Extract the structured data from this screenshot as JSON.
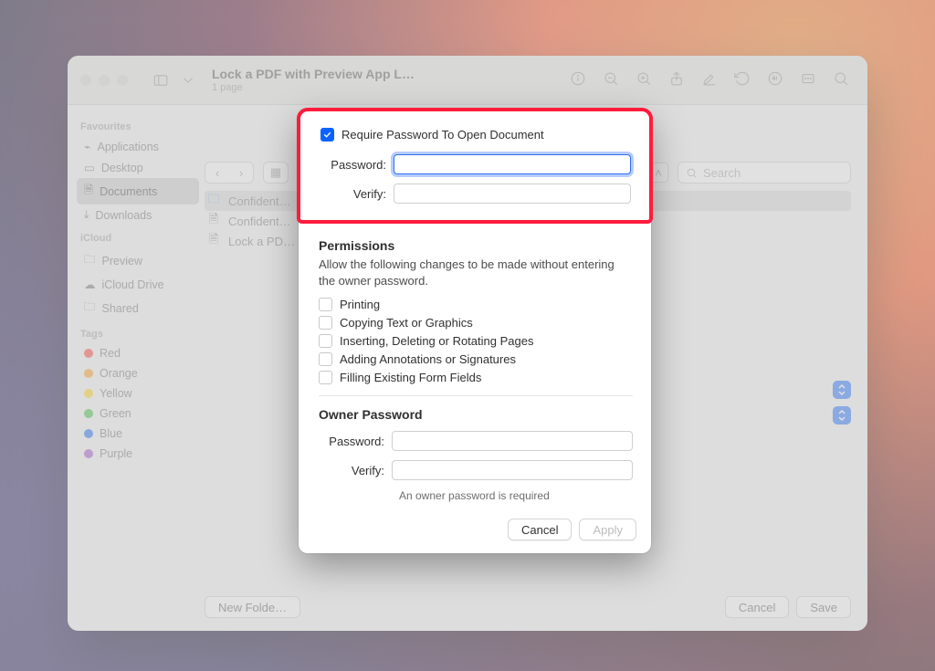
{
  "window": {
    "title": "Lock a PDF with Preview App L…",
    "subtitle": "1 page"
  },
  "sidebar": {
    "groups": [
      {
        "header": "Favourites",
        "items": [
          "Applications",
          "Desktop",
          "Documents",
          "Downloads"
        ],
        "selectedIndex": 2
      },
      {
        "header": "iCloud",
        "items": [
          "Preview",
          "iCloud Drive",
          "Shared"
        ]
      },
      {
        "header": "Tags",
        "items": [
          "Red",
          "Orange",
          "Yellow",
          "Green",
          "Blue",
          "Purple"
        ],
        "colors": [
          "#ff5b56",
          "#ffab3d",
          "#ffd93b",
          "#59c957",
          "#3a81f6",
          "#b06bd6"
        ]
      }
    ]
  },
  "search": {
    "placeholder": "Search"
  },
  "files": {
    "items": [
      "Confident…",
      "Confident…",
      "Lock a PD…"
    ],
    "selectedIndex": 0
  },
  "sheet_footer": {
    "new_folder": "New Folde…",
    "cancel": "Cancel",
    "save": "Save"
  },
  "dialog": {
    "require_label": "Require Password To Open Document",
    "password_label": "Password:",
    "verify_label": "Verify:",
    "permissions_header": "Permissions",
    "permissions_blurb": "Allow the following changes to be made without entering the owner password.",
    "perms": [
      "Printing",
      "Copying Text or Graphics",
      "Inserting, Deleting or Rotating Pages",
      "Adding Annotations or Signatures",
      "Filling Existing Form Fields"
    ],
    "owner_header": "Owner Password",
    "owner_required": "An owner password is required",
    "cancel": "Cancel",
    "apply": "Apply"
  }
}
